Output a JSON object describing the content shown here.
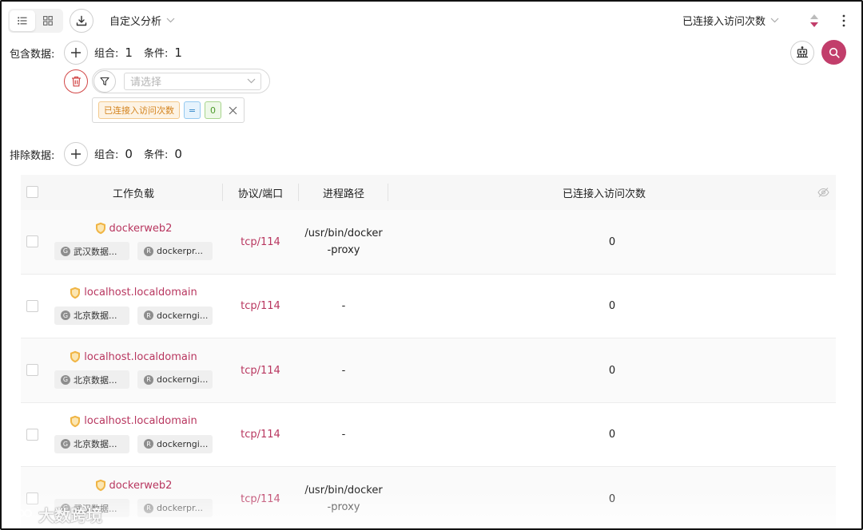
{
  "toolbar": {
    "analysis_label": "自定义分析",
    "sort_label": "已连接入访问次数"
  },
  "include": {
    "label": "包含数据:",
    "group_label": "组合:",
    "group_count": "1",
    "cond_label": "条件:",
    "cond_count": "1",
    "select_placeholder": "请选择",
    "condition": {
      "field": "已连接入访问次数",
      "op": "=",
      "value": "0"
    }
  },
  "exclude": {
    "label": "排除数据:",
    "group_label": "组合:",
    "group_count": "0",
    "cond_label": "条件:",
    "cond_count": "0"
  },
  "table": {
    "columns": [
      "工作负载",
      "协议/端口",
      "进程路径",
      "已连接入访问次数"
    ],
    "rows": [
      {
        "name": "dockerweb2",
        "chip1": "武汉数据...",
        "chip2": "dockerpr...",
        "port": "tcp/114",
        "path": "/usr/bin/docker-proxy",
        "count": "0"
      },
      {
        "name": "localhost.localdomain",
        "chip1": "北京数据...",
        "chip2": "dockerngi...",
        "port": "tcp/114",
        "path": "-",
        "count": "0"
      },
      {
        "name": "localhost.localdomain",
        "chip1": "北京数据...",
        "chip2": "dockerngi...",
        "port": "tcp/114",
        "path": "-",
        "count": "0"
      },
      {
        "name": "localhost.localdomain",
        "chip1": "北京数据...",
        "chip2": "dockerngi...",
        "port": "tcp/114",
        "path": "-",
        "count": "0"
      },
      {
        "name": "dockerweb2",
        "chip1": "武汉数据...",
        "chip2": "dockerpr...",
        "port": "tcp/114",
        "path": "/usr/bin/docker-proxy",
        "count": "0"
      }
    ],
    "chip1_badge": "G",
    "chip2_badge": "R"
  },
  "watermark": "大数跨境",
  "colors": {
    "accent": "#c23e6b",
    "link": "#b8365f",
    "danger": "#d24646",
    "shield": "#f0b545"
  }
}
